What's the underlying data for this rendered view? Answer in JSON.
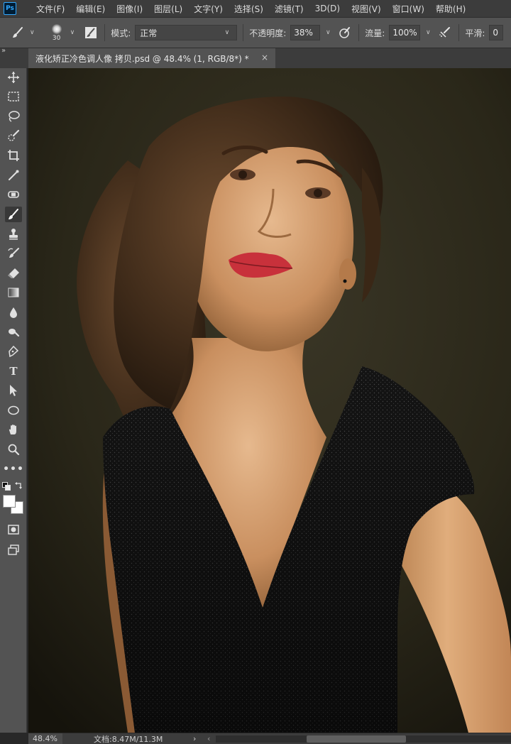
{
  "app": {
    "logo_text": "Ps",
    "menu": [
      "文件(F)",
      "编辑(E)",
      "图像(I)",
      "图层(L)",
      "文字(Y)",
      "选择(S)",
      "滤镜(T)",
      "3D(D)",
      "视图(V)",
      "窗口(W)",
      "帮助(H)"
    ]
  },
  "options_bar": {
    "brush_size": "30",
    "mode_label": "模式:",
    "mode_value": "正常",
    "opacity_label": "不透明度:",
    "opacity_value": "38%",
    "flow_label": "流量:",
    "flow_value": "100%",
    "smoothing_label": "平滑:",
    "smoothing_value": "0"
  },
  "document": {
    "tab_title": "液化矫正冷色调人像 拷贝.psd @ 48.4% (1, RGB/8*) *",
    "close_glyph": "×"
  },
  "toolbar": {
    "collapse_glyph": "»",
    "active_tool": "brush-tool",
    "tools": [
      "move-tool",
      "rectangular-marquee-tool",
      "lasso-tool",
      "quick-selection-tool",
      "crop-tool",
      "eyedropper-tool",
      "spot-healing-brush-tool",
      "brush-tool",
      "clone-stamp-tool",
      "history-brush-tool",
      "eraser-tool",
      "gradient-tool",
      "blur-tool",
      "dodge-tool",
      "pen-tool",
      "type-tool",
      "path-selection-tool",
      "ellipse-tool",
      "hand-tool",
      "zoom-tool",
      "edit-toolbar",
      "default-colors",
      "swap-colors",
      "foreground-color",
      "background-color",
      "quick-mask",
      "screen-mode"
    ],
    "type_glyph": "T",
    "more_glyph": "•••",
    "foreground_color": "#ffffff",
    "background_color": "#ffffff"
  },
  "status_bar": {
    "zoom": "48.4%",
    "doc_info": "文档:8.47M/11.3M",
    "arrow_glyph": "›",
    "scroll_left_glyph": "‹"
  }
}
